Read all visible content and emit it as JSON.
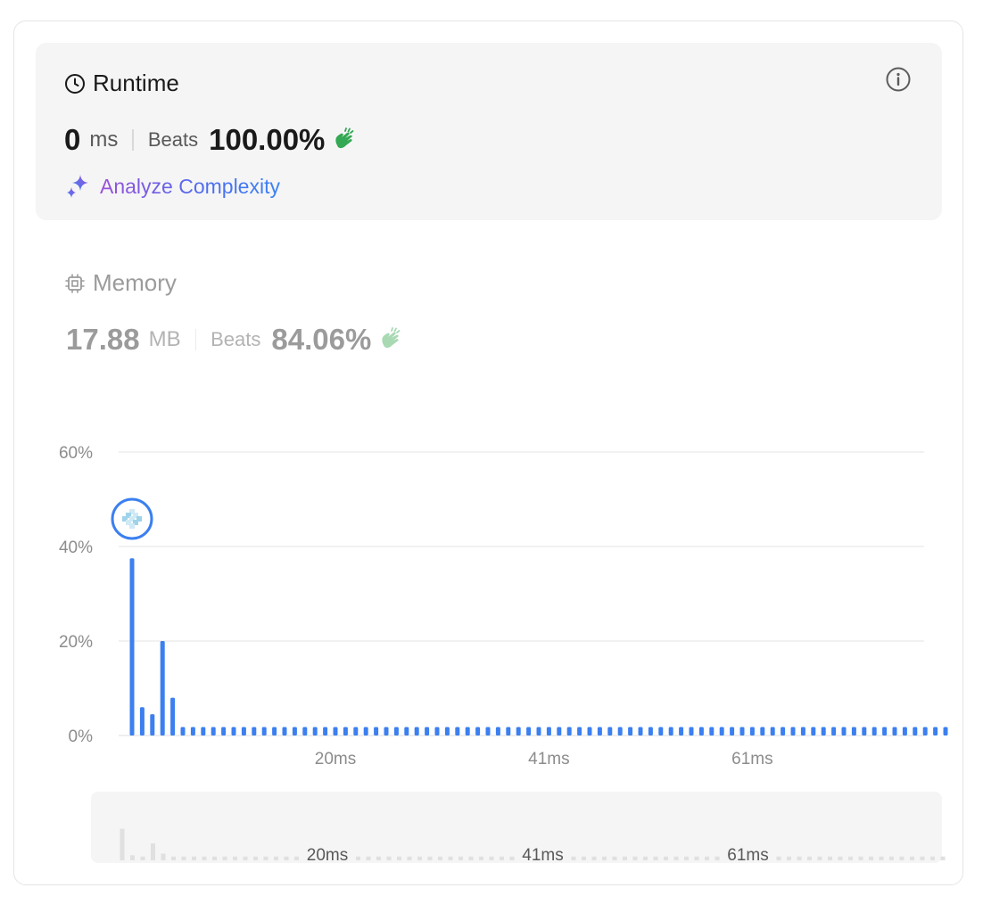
{
  "runtime": {
    "title": "Runtime",
    "value": "0",
    "unit": "ms",
    "beats_label": "Beats",
    "beats_value": "100.00%",
    "analyze_label": "Analyze Complexity"
  },
  "memory": {
    "title": "Memory",
    "value": "17.88",
    "unit": "MB",
    "beats_label": "Beats",
    "beats_value": "84.06%"
  },
  "colors": {
    "accent_blue": "#3b7ff0",
    "clap_green": "#34a853",
    "panel_bg": "#f5f5f5"
  },
  "chart_data": {
    "type": "bar",
    "y_ticks": [
      "60%",
      "40%",
      "20%",
      "0%"
    ],
    "ylim": [
      0,
      60
    ],
    "x_tick_labels": [
      "20ms",
      "41ms",
      "61ms"
    ],
    "x_tick_positions": [
      20,
      41,
      61
    ],
    "x": [
      0,
      1,
      2,
      3,
      4,
      5,
      6,
      7,
      8,
      9,
      10,
      11,
      12,
      13,
      14,
      15,
      16,
      17,
      18,
      19,
      20,
      21,
      22,
      23,
      24,
      25,
      26,
      27,
      28,
      29,
      30,
      31,
      32,
      33,
      34,
      35,
      36,
      37,
      38,
      39,
      40,
      41,
      42,
      43,
      44,
      45,
      46,
      47,
      48,
      49,
      50,
      51,
      52,
      53,
      54,
      55,
      56,
      57,
      58,
      59,
      60,
      61,
      62,
      63,
      64,
      65,
      66,
      67,
      68,
      69,
      70,
      71,
      72,
      73,
      74,
      75,
      76,
      77,
      78,
      79,
      80
    ],
    "values": [
      37.5,
      6,
      4.5,
      20,
      8,
      1.8,
      1.8,
      1.8,
      1.8,
      1.8,
      1.8,
      1.8,
      1.8,
      1.8,
      1.8,
      1.8,
      1.8,
      1.8,
      1.8,
      1.8,
      1.8,
      1.8,
      1.8,
      1.8,
      1.8,
      1.8,
      1.8,
      1.8,
      1.8,
      1.8,
      1.8,
      1.8,
      1.8,
      1.8,
      1.8,
      1.8,
      1.8,
      1.8,
      1.8,
      1.8,
      1.8,
      1.8,
      1.8,
      1.8,
      1.8,
      1.8,
      1.8,
      1.8,
      1.8,
      1.8,
      1.8,
      1.8,
      1.8,
      1.8,
      1.8,
      1.8,
      1.8,
      1.8,
      1.8,
      1.8,
      1.8,
      1.8,
      1.8,
      1.8,
      1.8,
      1.8,
      1.8,
      1.8,
      1.8,
      1.8,
      1.8,
      1.8,
      1.8,
      1.8,
      1.8,
      1.8,
      1.8,
      1.8,
      1.8,
      1.8,
      1.8
    ],
    "marker_index": 0,
    "grid": true
  }
}
